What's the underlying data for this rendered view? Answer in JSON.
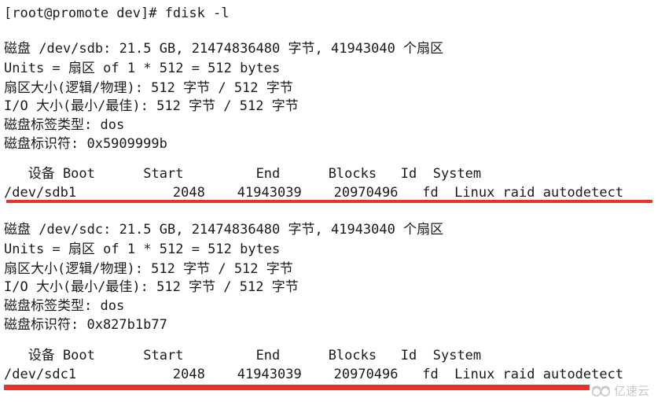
{
  "terminal": {
    "background_color": "#ffffff",
    "text_color": "#1a1a1a",
    "rule_color": "#ee3124",
    "prompt_line": "[root@promote dev]# fdisk -l",
    "disks": [
      {
        "id": "sdb",
        "summary": "磁盘 /dev/sdb: 21.5 GB, 21474836480 字节, 41943040 个扇区",
        "units": "Units = 扇区 of 1 * 512 = 512 bytes",
        "sector_size": "扇区大小(逻辑/物理): 512 字节 / 512 字节",
        "io_size": "I/O 大小(最小/最佳): 512 字节 / 512 字节",
        "label_type": "磁盘标签类型: dos",
        "identifier": "磁盘标识符: 0x5909999b",
        "table_header": "   设备 Boot      Start         End      Blocks   Id  System",
        "partition_row": "/dev/sdb1            2048    41943039    20970496   fd  Linux raid autodetect",
        "partition": {
          "device": "/dev/sdb1",
          "boot": "",
          "start": "2048",
          "end": "41943039",
          "blocks": "20970496",
          "type_id": "fd",
          "system": "Linux raid autodetect"
        },
        "size_human": "21.5 GB",
        "size_bytes": "21474836480",
        "sectors": "41943040",
        "disk_identifier_value": "0x5909999b",
        "disk_label_value": "dos"
      },
      {
        "id": "sdc",
        "summary": "磁盘 /dev/sdc: 21.5 GB, 21474836480 字节, 41943040 个扇区",
        "units": "Units = 扇区 of 1 * 512 = 512 bytes",
        "sector_size": "扇区大小(逻辑/物理): 512 字节 / 512 字节",
        "io_size": "I/O 大小(最小/最佳): 512 字节 / 512 字节",
        "label_type": "磁盘标签类型: dos",
        "identifier": "磁盘标识符: 0x827b1b77",
        "table_header": "   设备 Boot      Start         End      Blocks   Id  System",
        "partition_row": "/dev/sdc1            2048    41943039    20970496   fd  Linux raid autodetect",
        "partition": {
          "device": "/dev/sdc1",
          "boot": "",
          "start": "2048",
          "end": "41943039",
          "blocks": "20970496",
          "type_id": "fd",
          "system": "Linux raid autodetect"
        },
        "size_human": "21.5 GB",
        "size_bytes": "21474836480",
        "sectors": "41943040",
        "disk_identifier_value": "0x827b1b77",
        "disk_label_value": "dos"
      }
    ],
    "table_columns": [
      "设备",
      "Boot",
      "Start",
      "End",
      "Blocks",
      "Id",
      "System"
    ]
  },
  "watermark": {
    "text": "亿速云",
    "logo_icon": "cloud-logo-icon",
    "color": "#9a9a9a"
  }
}
